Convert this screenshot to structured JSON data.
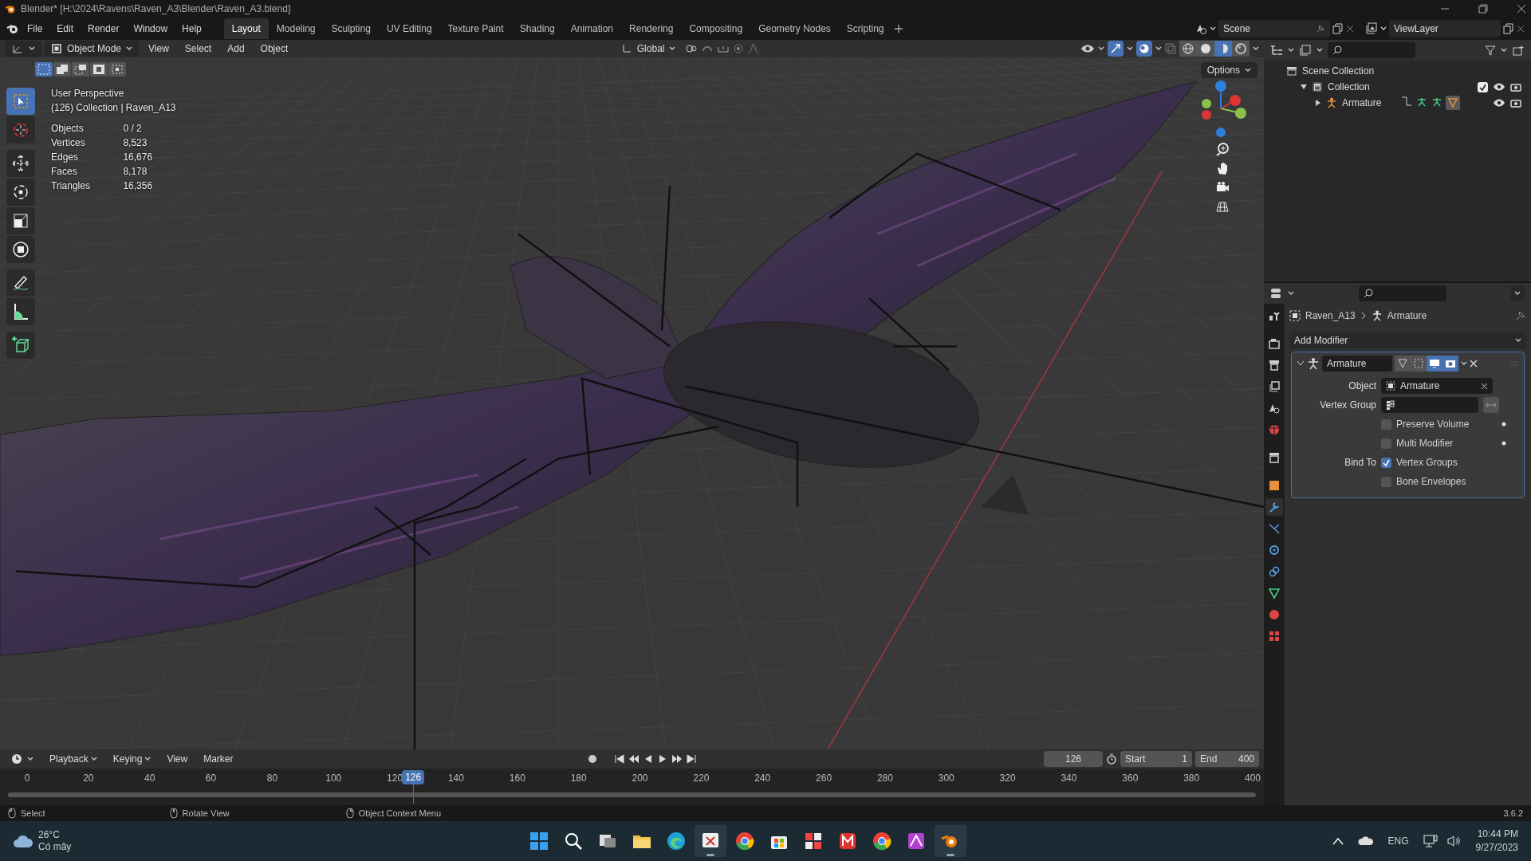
{
  "window": {
    "title": "Blender* [H:\\2024\\Ravens\\Raven_A3\\Blender\\Raven_A3.blend]"
  },
  "menu": [
    "File",
    "Edit",
    "Render",
    "Window",
    "Help"
  ],
  "workspaces": [
    {
      "label": "Layout",
      "selected": true
    },
    {
      "label": "Modeling",
      "selected": false
    },
    {
      "label": "Sculpting",
      "selected": false
    },
    {
      "label": "UV Editing",
      "selected": false
    },
    {
      "label": "Texture Paint",
      "selected": false
    },
    {
      "label": "Shading",
      "selected": false
    },
    {
      "label": "Animation",
      "selected": false
    },
    {
      "label": "Rendering",
      "selected": false
    },
    {
      "label": "Compositing",
      "selected": false
    },
    {
      "label": "Geometry Nodes",
      "selected": false
    },
    {
      "label": "Scripting",
      "selected": false
    }
  ],
  "scene": "Scene",
  "view_layer": "ViewLayer",
  "viewport_header": {
    "mode": "Object Mode",
    "menus": [
      "View",
      "Select",
      "Add",
      "Object"
    ],
    "orientation": "Global",
    "options": "Options"
  },
  "viewport": {
    "view_name": "User Perspective",
    "collection": "(126) Collection | Raven_A13",
    "stats": [
      {
        "label": "Objects",
        "value": "0 / 2"
      },
      {
        "label": "Vertices",
        "value": "8,523"
      },
      {
        "label": "Edges",
        "value": "16,676"
      },
      {
        "label": "Faces",
        "value": "8,178"
      },
      {
        "label": "Triangles",
        "value": "16,356"
      }
    ]
  },
  "tools": [
    {
      "kind": "select",
      "selected": true
    },
    {
      "kind": "cursor",
      "selected": false
    },
    {
      "kind": "move",
      "selected": false
    },
    {
      "kind": "rotate",
      "selected": false
    },
    {
      "kind": "scale",
      "selected": false
    },
    {
      "kind": "transform",
      "selected": false
    },
    {
      "kind": "annotate",
      "selected": false
    },
    {
      "kind": "measure",
      "selected": false
    },
    {
      "kind": "add_cube",
      "selected": false
    }
  ],
  "shading_modes": [
    {
      "kind": "wireframe",
      "selected": false
    },
    {
      "kind": "solid",
      "selected": false
    },
    {
      "kind": "material",
      "selected": true
    },
    {
      "kind": "rendered",
      "selected": false
    }
  ],
  "outliner": {
    "items": [
      {
        "label": "Scene Collection",
        "kind": "scene",
        "children": [
          {
            "label": "Collection",
            "kind": "collection",
            "expanded": true,
            "checked": true,
            "children": [
              {
                "label": "Armature",
                "kind": "armature",
                "expanded": false
              }
            ]
          }
        ]
      }
    ]
  },
  "properties": {
    "tabs": [
      {
        "kind": "tool",
        "selected": false
      },
      {
        "kind": "render",
        "selected": false
      },
      {
        "kind": "output",
        "selected": false
      },
      {
        "kind": "view_layer",
        "selected": false
      },
      {
        "kind": "scene",
        "selected": false
      },
      {
        "kind": "world",
        "selected": false
      },
      {
        "kind": "collection",
        "selected": false
      },
      {
        "kind": "object",
        "selected": false
      },
      {
        "kind": "modifier",
        "selected": true
      },
      {
        "kind": "particles",
        "selected": false
      },
      {
        "kind": "physics",
        "selected": false
      },
      {
        "kind": "constraints",
        "selected": false
      },
      {
        "kind": "data",
        "selected": false
      },
      {
        "kind": "material",
        "selected": false
      },
      {
        "kind": "texture",
        "selected": false
      }
    ],
    "breadcrumb": [
      "Raven_A13",
      "Armature"
    ],
    "add_modifier": "Add Modifier",
    "modifier": {
      "name": "Armature",
      "expanded": true,
      "rows": [
        {
          "kind": "object",
          "label": "Object",
          "value": "Armature"
        },
        {
          "kind": "vertex_group",
          "label": "Vertex Group"
        },
        {
          "kind": "checkbox",
          "text": "Preserve Volume",
          "checked": false
        },
        {
          "kind": "checkbox",
          "text": "Multi Modifier",
          "checked": false
        },
        {
          "kind": "checkbox",
          "label": "Bind To",
          "text": "Vertex Groups",
          "checked": true
        },
        {
          "kind": "checkbox",
          "text": "Bone Envelopes",
          "checked": false
        }
      ]
    }
  },
  "timeline": {
    "menus": [
      "Playback",
      "Keying",
      "View",
      "Marker"
    ],
    "current_frame": "126",
    "start_label": "Start",
    "start": "1",
    "end_label": "End",
    "end": "400",
    "ticks": [
      "0",
      "20",
      "40",
      "60",
      "80",
      "100",
      "120",
      "140",
      "160",
      "180",
      "200",
      "220",
      "240",
      "260",
      "280",
      "300",
      "320",
      "340",
      "360",
      "380",
      "400"
    ],
    "playhead": {
      "label": "126",
      "level": 0.315
    }
  },
  "status_bar": {
    "hints": [
      "Select",
      "Rotate View",
      "Object Context Menu"
    ],
    "version": "3.6.2"
  },
  "taskbar": {
    "weather": {
      "temp": "26°C",
      "desc": "Có mây"
    },
    "apps": [
      {
        "kind": "start",
        "selected": false
      },
      {
        "kind": "search",
        "selected": false
      },
      {
        "kind": "task_view",
        "selected": false
      },
      {
        "kind": "folder",
        "selected": false
      },
      {
        "kind": "browser",
        "selected": false
      },
      {
        "kind": "snip",
        "selected": true
      },
      {
        "kind": "chrome",
        "selected": false
      },
      {
        "kind": "store",
        "selected": false
      },
      {
        "kind": "grid",
        "selected": false
      },
      {
        "kind": "mail",
        "selected": false
      },
      {
        "kind": "chrome",
        "selected": false
      },
      {
        "kind": "paint",
        "selected": false
      },
      {
        "kind": "blender",
        "selected": true
      }
    ],
    "language": "ENG",
    "time": "10:44 PM",
    "date": "9/27/2023"
  }
}
